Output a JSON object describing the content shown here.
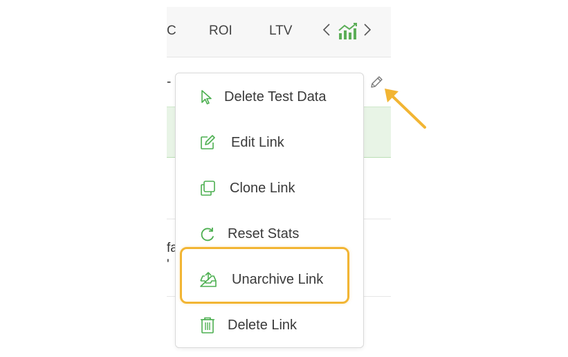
{
  "header": {
    "col_fragment": "C",
    "col_roi": "ROI",
    "col_ltv": "LTV",
    "nav_prev_icon": "chevron-left-icon",
    "chart_icon": "bar-chart-trend-icon",
    "nav_next_icon": "chevron-right-icon"
  },
  "rows": {
    "fragment_dash": "-",
    "fragment_fa": "fa",
    "fragment_quote": "'"
  },
  "row_action": {
    "icon": "pencil-icon"
  },
  "context_menu": {
    "items": [
      {
        "label": "Delete Test Data",
        "icon": "cursor-pointer-icon"
      },
      {
        "label": "Edit Link",
        "icon": "edit-square-icon"
      },
      {
        "label": "Clone Link",
        "icon": "copy-icon"
      },
      {
        "label": "Reset Stats",
        "icon": "refresh-icon"
      },
      {
        "label": "Unarchive Link",
        "icon": "unarchive-tray-icon",
        "highlighted": true
      },
      {
        "label": "Delete Link",
        "icon": "trash-icon"
      }
    ]
  },
  "colors": {
    "accent_green": "#4caf50",
    "highlight_orange": "#f2b533",
    "row_highlight": "#e8f4e6"
  }
}
